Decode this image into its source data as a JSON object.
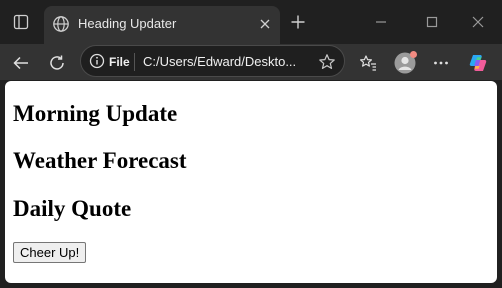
{
  "browser": {
    "tab_title": "Heading Updater",
    "address_scheme": "File",
    "address_url": "C:/Users/Edward/Deskto..."
  },
  "page": {
    "headings": [
      "Morning Update",
      "Weather Forecast",
      "Daily Quote"
    ],
    "button_label": "Cheer Up!"
  },
  "icons": {
    "tab_actions": "tab-actions-icon",
    "favicon": "globe-icon",
    "tab_close": "close-icon",
    "new_tab": "plus-icon",
    "minimize": "minimize-icon",
    "maximize": "maximize-icon",
    "close_window": "close-icon",
    "back": "back-arrow-icon",
    "reload": "reload-icon",
    "site_info": "info-icon",
    "favorite": "star-icon",
    "favorites_list": "favorites-icon",
    "profile": "avatar",
    "more": "more-icon",
    "copilot": "copilot-icon"
  },
  "colors": {
    "titlebar": "#202020",
    "toolbar": "#333333",
    "page_background": "#ffffff",
    "text_light": "#e8e8e8"
  }
}
